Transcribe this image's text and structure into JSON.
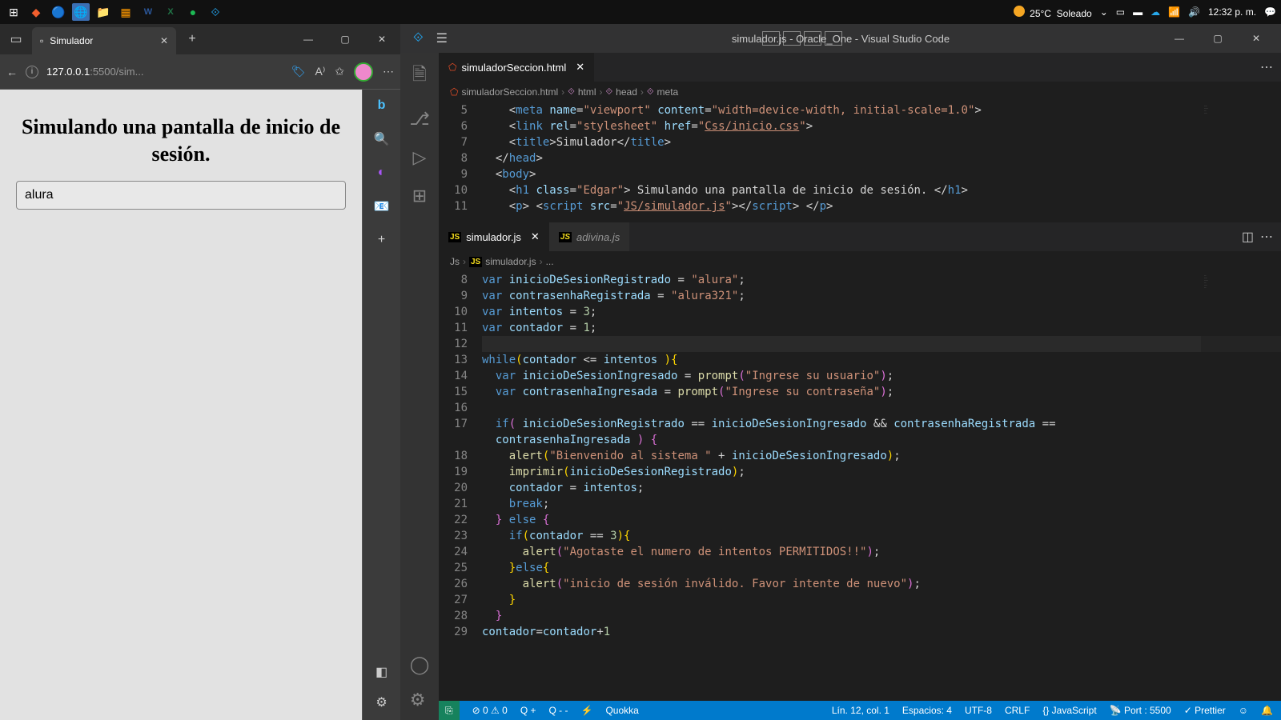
{
  "taskbar": {
    "weather_temp": "25°C",
    "weather_desc": "Soleado",
    "time": "12:32 p. m."
  },
  "browser": {
    "tab_title": "Simulador",
    "url_host": "127.0.0.1",
    "url_port": ":5500",
    "url_path": "/sim...",
    "page_heading": "Simulando una pantalla de inicio de sesión.",
    "input_value": "alura"
  },
  "vscode": {
    "title": "simulador.js - Oracle_One - Visual Studio Code",
    "group1": {
      "tabs": [
        {
          "label": "simuladorSeccion.html",
          "active": true
        }
      ],
      "breadcrumb": [
        "simuladorSeccion.html",
        "html",
        "head",
        "meta"
      ],
      "lines": [
        {
          "n": 5,
          "html": "    <span class='tok-pun'>&lt;</span><span class='tok-tag'>meta</span> <span class='tok-attr'>name</span>=<span class='tok-str'>\"viewport\"</span> <span class='tok-attr'>content</span>=<span class='tok-str'>\"width=device-width, initial-scale=1.0\"</span><span class='tok-pun'>&gt;</span>"
        },
        {
          "n": 6,
          "html": "    <span class='tok-pun'>&lt;</span><span class='tok-tag'>link</span> <span class='tok-attr'>rel</span>=<span class='tok-str'>\"stylesheet\"</span> <span class='tok-attr'>href</span>=<span class='tok-str'>\"</span><span class='tok-link'>Css/inicio.css</span><span class='tok-str'>\"</span><span class='tok-pun'>&gt;</span>"
        },
        {
          "n": 7,
          "html": "    <span class='tok-pun'>&lt;</span><span class='tok-tag'>title</span><span class='tok-pun'>&gt;</span>Simulador<span class='tok-pun'>&lt;/</span><span class='tok-tag'>title</span><span class='tok-pun'>&gt;</span>"
        },
        {
          "n": 8,
          "html": "  <span class='tok-pun'>&lt;/</span><span class='tok-tag'>head</span><span class='tok-pun'>&gt;</span>"
        },
        {
          "n": 9,
          "html": "  <span class='tok-pun'>&lt;</span><span class='tok-tag'>body</span><span class='tok-pun'>&gt;</span>"
        },
        {
          "n": 10,
          "html": "    <span class='tok-pun'>&lt;</span><span class='tok-tag'>h1</span> <span class='tok-attr'>class</span>=<span class='tok-str'>\"Edgar\"</span><span class='tok-pun'>&gt;</span> Simulando una pantalla de inicio de sesión. <span class='tok-pun'>&lt;/</span><span class='tok-tag'>h1</span><span class='tok-pun'>&gt;</span>"
        },
        {
          "n": 11,
          "html": "    <span class='tok-pun'>&lt;</span><span class='tok-tag'>p</span><span class='tok-pun'>&gt;</span> <span class='tok-pun'>&lt;</span><span class='tok-tag'>script</span> <span class='tok-attr'>src</span>=<span class='tok-str'>\"</span><span class='tok-link'>JS/simulador.js</span><span class='tok-str'>\"</span><span class='tok-pun'>&gt;&lt;/</span><span class='tok-tag'>script</span><span class='tok-pun'>&gt;</span> <span class='tok-pun'>&lt;/</span><span class='tok-tag'>p</span><span class='tok-pun'>&gt;</span>"
        }
      ]
    },
    "group2": {
      "tabs": [
        {
          "label": "simulador.js",
          "active": true
        },
        {
          "label": "adivina.js",
          "active": false,
          "italic": true
        }
      ],
      "breadcrumb": [
        "Js",
        "simulador.js",
        "..."
      ],
      "lines": [
        {
          "n": 8,
          "html": "<span class='tok-kw'>var</span> <span class='tok-var'>inicioDeSesionRegistrado</span> = <span class='tok-str'>\"alura\"</span>;"
        },
        {
          "n": 9,
          "html": "<span class='tok-kw'>var</span> <span class='tok-var'>contrasenhaRegistrada</span> = <span class='tok-str'>\"alura321\"</span>;"
        },
        {
          "n": 10,
          "html": "<span class='tok-kw'>var</span> <span class='tok-var'>intentos</span> = <span class='tok-num'>3</span>;"
        },
        {
          "n": 11,
          "html": "<span class='tok-kw'>var</span> <span class='tok-var'>contador</span> = <span class='tok-num'>1</span>;"
        },
        {
          "n": 12,
          "html": "",
          "current": true
        },
        {
          "n": 13,
          "html": "<span class='tok-kw'>while</span><span class='tok-brace'>(</span><span class='tok-var'>contador</span> &lt;= <span class='tok-var'>intentos</span> <span class='tok-brace'>)</span><span class='tok-brace'>{</span>"
        },
        {
          "n": 14,
          "html": "  <span class='tok-kw'>var</span> <span class='tok-var'>inicioDeSesionIngresado</span> = <span class='tok-func'>prompt</span><span class='tok-brace2'>(</span><span class='tok-str'>\"Ingrese su usuario\"</span><span class='tok-brace2'>)</span>;"
        },
        {
          "n": 15,
          "html": "  <span class='tok-kw'>var</span> <span class='tok-var'>contrasenhaIngresada</span> = <span class='tok-func'>prompt</span><span class='tok-brace2'>(</span><span class='tok-str'>\"Ingrese su contraseña\"</span><span class='tok-brace2'>)</span>;"
        },
        {
          "n": 16,
          "html": ""
        },
        {
          "n": 17,
          "html": "  <span class='tok-kw'>if</span><span class='tok-brace2'>(</span> <span class='tok-var'>inicioDeSesionRegistrado</span> == <span class='tok-var'>inicioDeSesionIngresado</span> &amp;&amp; <span class='tok-var'>contrasenhaRegistrada</span> =="
        },
        {
          "n": "",
          "html": "  <span class='tok-var'>contrasenhaIngresada</span> <span class='tok-brace2'>)</span> <span class='tok-brace2'>{</span>"
        },
        {
          "n": 18,
          "html": "    <span class='tok-func'>alert</span><span class='tok-brace'>(</span><span class='tok-str'>\"Bienvenido al sistema \"</span> + <span class='tok-var'>inicioDeSesionIngresado</span><span class='tok-brace'>)</span>;"
        },
        {
          "n": 19,
          "html": "    <span class='tok-func'>imprimir</span><span class='tok-brace'>(</span><span class='tok-var'>inicioDeSesionRegistrado</span><span class='tok-brace'>)</span>;"
        },
        {
          "n": 20,
          "html": "    <span class='tok-var'>contador</span> = <span class='tok-var'>intentos</span>;"
        },
        {
          "n": 21,
          "html": "    <span class='tok-kw'>break</span>;"
        },
        {
          "n": 22,
          "html": "  <span class='tok-brace2'>}</span> <span class='tok-kw'>else</span> <span class='tok-brace2'>{</span>"
        },
        {
          "n": 23,
          "html": "    <span class='tok-kw'>if</span><span class='tok-brace'>(</span><span class='tok-var'>contador</span> == <span class='tok-num'>3</span><span class='tok-brace'>)</span><span class='tok-brace'>{</span>"
        },
        {
          "n": 24,
          "html": "      <span class='tok-func'>alert</span><span class='tok-brace2'>(</span><span class='tok-str'>\"Agotaste el numero de intentos PERMITIDOS!!\"</span><span class='tok-brace2'>)</span>;"
        },
        {
          "n": 25,
          "html": "    <span class='tok-brace'>}</span><span class='tok-kw'>else</span><span class='tok-brace'>{</span>"
        },
        {
          "n": 26,
          "html": "      <span class='tok-func'>alert</span><span class='tok-brace2'>(</span><span class='tok-str'>\"inicio de sesión inválido. Favor intente de nuevo\"</span><span class='tok-brace2'>)</span>;"
        },
        {
          "n": 27,
          "html": "    <span class='tok-brace'>}</span>"
        },
        {
          "n": 28,
          "html": "  <span class='tok-brace2'>}</span>"
        },
        {
          "n": 29,
          "html": "<span class='tok-var'>contador</span>=<span class='tok-var'>contador</span>+<span class='tok-num'>1</span>"
        }
      ]
    },
    "status": {
      "errors": "0",
      "warnings": "0",
      "q_plus": "Q +",
      "q_minus": "Q - -",
      "quokka": "Quokka",
      "position": "Lín. 12, col. 1",
      "spaces": "Espacios: 4",
      "encoding": "UTF-8",
      "eol": "CRLF",
      "lang": "JavaScript",
      "port": "Port : 5500",
      "prettier": "Prettier"
    }
  }
}
